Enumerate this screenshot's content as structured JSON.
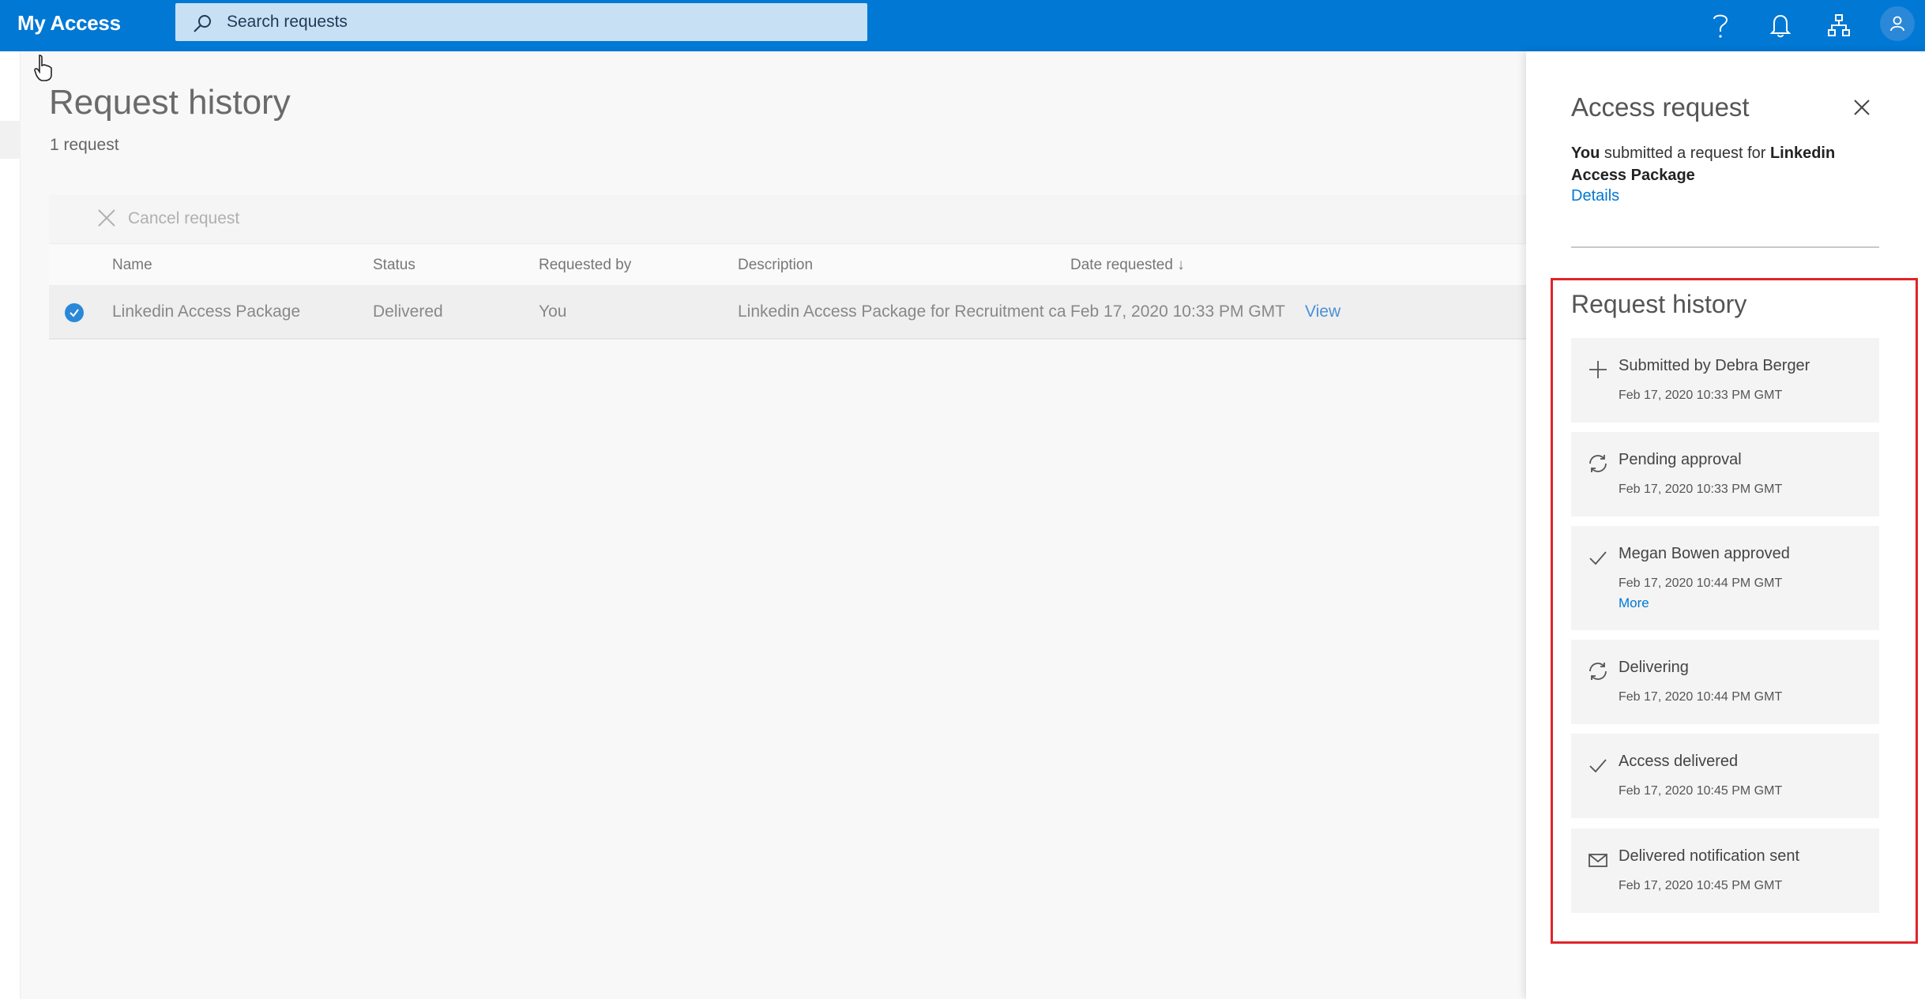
{
  "app": {
    "title": "My Access",
    "search_placeholder": "Search requests"
  },
  "topbar_icons": [
    "help-icon",
    "bell-icon",
    "org-chart-icon",
    "user-avatar-icon"
  ],
  "main": {
    "title": "Request history",
    "count": "1 request",
    "cancel_label": "Cancel request",
    "columns": {
      "name": "Name",
      "status": "Status",
      "requested_by": "Requested by",
      "description": "Description",
      "date": "Date requested ↓"
    },
    "rows": [
      {
        "name": "Linkedin Access Package",
        "status": "Delivered",
        "requested_by": "You",
        "description": "Linkedin Access Package for Recruitment ca",
        "date": "Feb 17, 2020 10:33 PM GMT",
        "action": "View"
      }
    ]
  },
  "panel": {
    "title": "Access request",
    "desc_you": "You",
    "desc_mid": " submitted a request for ",
    "desc_item": "Linkedin Access Package",
    "details_link": "Details",
    "history_title": "Request history",
    "history": [
      {
        "icon": "plus-icon",
        "label": "Submitted by Debra Berger",
        "time": "Feb 17, 2020 10:33 PM GMT",
        "more": ""
      },
      {
        "icon": "sync-icon",
        "label": "Pending approval",
        "time": "Feb 17, 2020 10:33 PM GMT",
        "more": ""
      },
      {
        "icon": "check-icon",
        "label": "Megan Bowen approved",
        "time": "Feb 17, 2020 10:44 PM GMT",
        "more": "More"
      },
      {
        "icon": "sync-icon",
        "label": "Delivering",
        "time": "Feb 17, 2020 10:44 PM GMT",
        "more": ""
      },
      {
        "icon": "check-icon",
        "label": "Access delivered",
        "time": "Feb 17, 2020 10:45 PM GMT",
        "more": ""
      },
      {
        "icon": "mail-icon",
        "label": "Delivered notification sent",
        "time": "Feb 17, 2020 10:45 PM GMT",
        "more": ""
      }
    ]
  },
  "colors": {
    "brand": "#0078d4",
    "search_bg": "#c7e0f4",
    "highlight_border": "#e0242a",
    "link": "#0078d4"
  }
}
